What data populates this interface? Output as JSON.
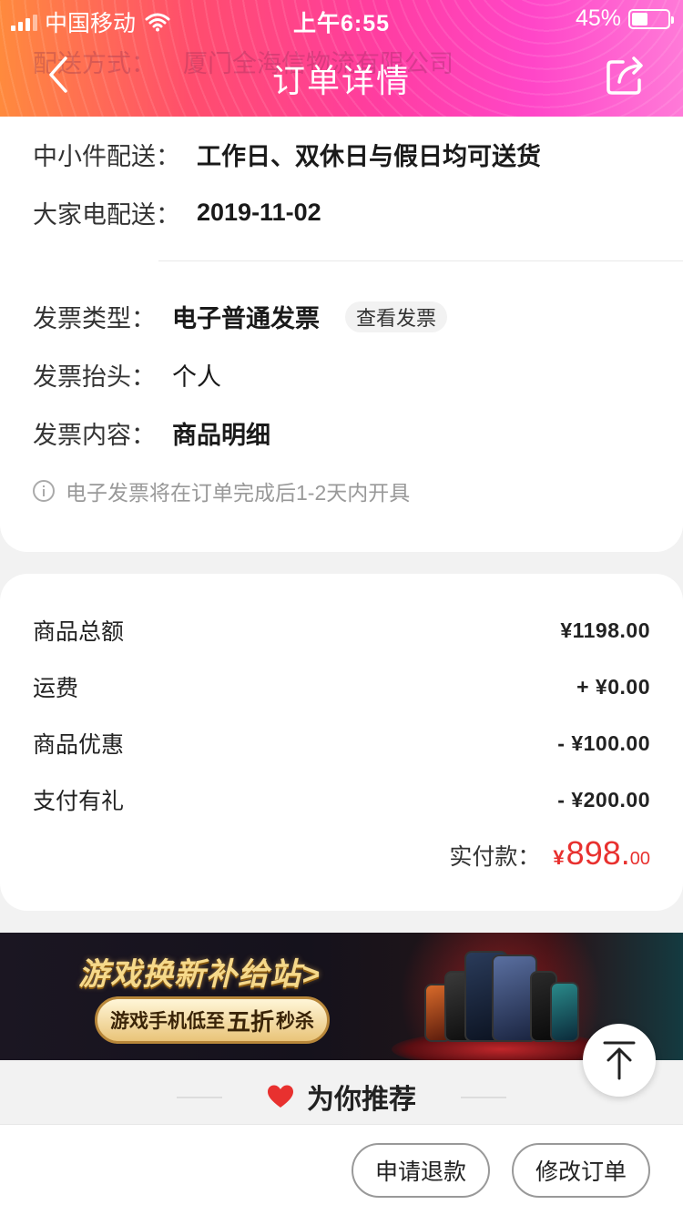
{
  "status_bar": {
    "carrier": "中国移动",
    "time": "上午6:55",
    "battery_percent": "45%",
    "battery_level": 0.45
  },
  "header": {
    "title": "订单详情",
    "ghost_text": "配送方式：",
    "ghost_company": "厦门全海信物流有限公司",
    "back_icon": "chevron-left-icon",
    "share_icon": "share-icon"
  },
  "delivery": {
    "small_label": "中小件配送：",
    "small_value": "工作日、双休日与假日均可送货",
    "large_label": "大家电配送：",
    "large_value": "2019-11-02"
  },
  "invoice": {
    "type_label": "发票类型：",
    "type_value": "电子普通发票",
    "view_button": "查看发票",
    "title_label": "发票抬头：",
    "title_value": "个人",
    "content_label": "发票内容：",
    "content_value": "商品明细",
    "notice": "电子发票将在订单完成后1-2天内开具"
  },
  "summary": {
    "rows": [
      {
        "label": "商品总额",
        "amount": "¥1198.00"
      },
      {
        "label": "运费",
        "amount": "+ ¥0.00"
      },
      {
        "label": "商品优惠",
        "amount": "- ¥100.00"
      },
      {
        "label": "支付有礼",
        "amount": "- ¥200.00"
      }
    ],
    "paid_label": "实付款：",
    "paid_symbol": "¥",
    "paid_main": "898.",
    "paid_decimal": "00"
  },
  "banner": {
    "title": "游戏换新补给站>",
    "pill_prefix": "游戏手机低至",
    "pill_highlight": "五折",
    "pill_suffix": "秒杀"
  },
  "recommend": {
    "title": "为你推荐"
  },
  "bottom": {
    "refund_button": "申请退款",
    "modify_button": "修改订单"
  },
  "colors": {
    "accent_red": "#e8312f",
    "header_gradient_start": "#ff8a3d",
    "header_gradient_end": "#ff7ad8"
  }
}
